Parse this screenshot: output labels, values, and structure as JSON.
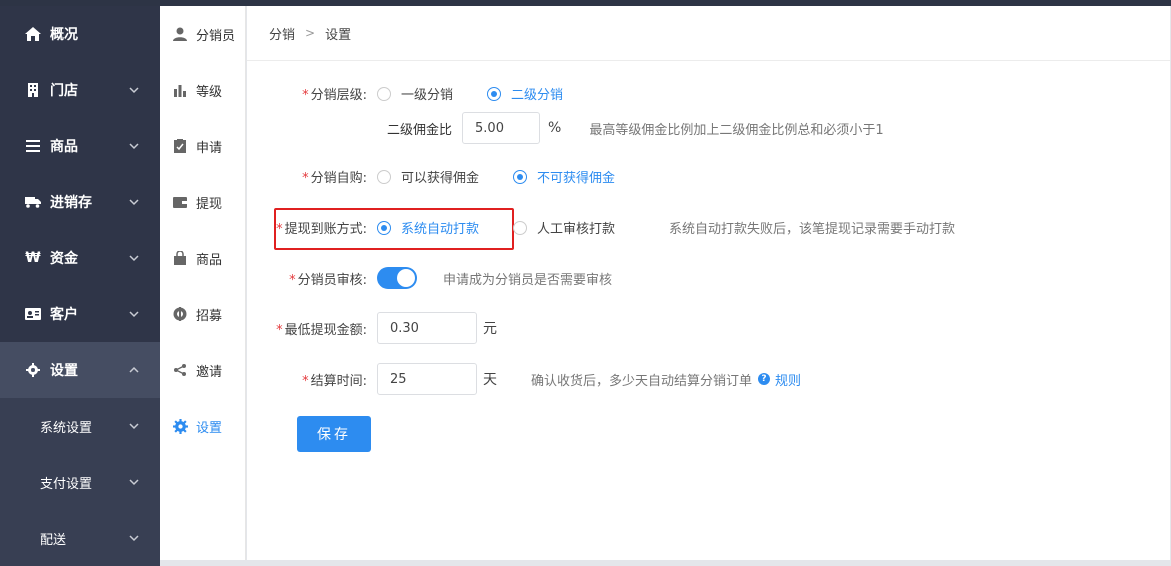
{
  "sidebar": {
    "items": [
      {
        "label": "概况",
        "icon": "home-icon"
      },
      {
        "label": "门店",
        "icon": "building-icon"
      },
      {
        "label": "商品",
        "icon": "list-icon"
      },
      {
        "label": "进销存",
        "icon": "truck-icon"
      },
      {
        "label": "资金",
        "icon": "won-icon"
      },
      {
        "label": "客户",
        "icon": "id-card-icon"
      },
      {
        "label": "设置",
        "icon": "gear-icon"
      }
    ],
    "sub_items": [
      {
        "label": "系统设置"
      },
      {
        "label": "支付设置"
      },
      {
        "label": "配送"
      }
    ]
  },
  "secondary_nav": {
    "items": [
      {
        "label": "分销员",
        "icon": "user-icon"
      },
      {
        "label": "等级",
        "icon": "bar-chart-icon"
      },
      {
        "label": "申请",
        "icon": "clipboard-check-icon"
      },
      {
        "label": "提现",
        "icon": "wallet-icon"
      },
      {
        "label": "商品",
        "icon": "bag-icon"
      },
      {
        "label": "招募",
        "icon": "target-icon"
      },
      {
        "label": "邀请",
        "icon": "share-icon"
      },
      {
        "label": "设置",
        "icon": "gear-icon"
      }
    ]
  },
  "breadcrumb": {
    "first": "分销",
    "separator": ">",
    "current": "设置"
  },
  "form": {
    "level": {
      "label": "分销层级:",
      "options": [
        "一级分销",
        "二级分销"
      ],
      "selected": "二级分销",
      "commission_label": "二级佣金比",
      "commission_value": "5.00",
      "commission_unit": "%",
      "commission_hint": "最高等级佣金比例加上二级佣金比例总和必须小于1"
    },
    "self_purchase": {
      "label": "分销自购:",
      "options": [
        "可以获得佣金",
        "不可获得佣金"
      ],
      "selected": "不可获得佣金"
    },
    "withdraw_method": {
      "label": "提现到账方式:",
      "options": [
        "系统自动打款",
        "人工审核打款"
      ],
      "selected": "系统自动打款",
      "hint": "系统自动打款失败后，该笔提现记录需要手动打款"
    },
    "review": {
      "label": "分销员审核:",
      "enabled": true,
      "hint": "申请成为分销员是否需要审核"
    },
    "min_withdraw": {
      "label": "最低提现金额:",
      "value": "0.30",
      "unit": "元"
    },
    "settle_time": {
      "label": "结算时间:",
      "value": "25",
      "unit": "天",
      "hint": "确认收货后，多少天自动结算分销订单",
      "help_label": "规则"
    },
    "required_mark": "*",
    "save_label": "保存"
  },
  "colors": {
    "accent": "#2d8cf0",
    "sidebar_bg": "#2f3548",
    "highlight": "#e02020"
  }
}
